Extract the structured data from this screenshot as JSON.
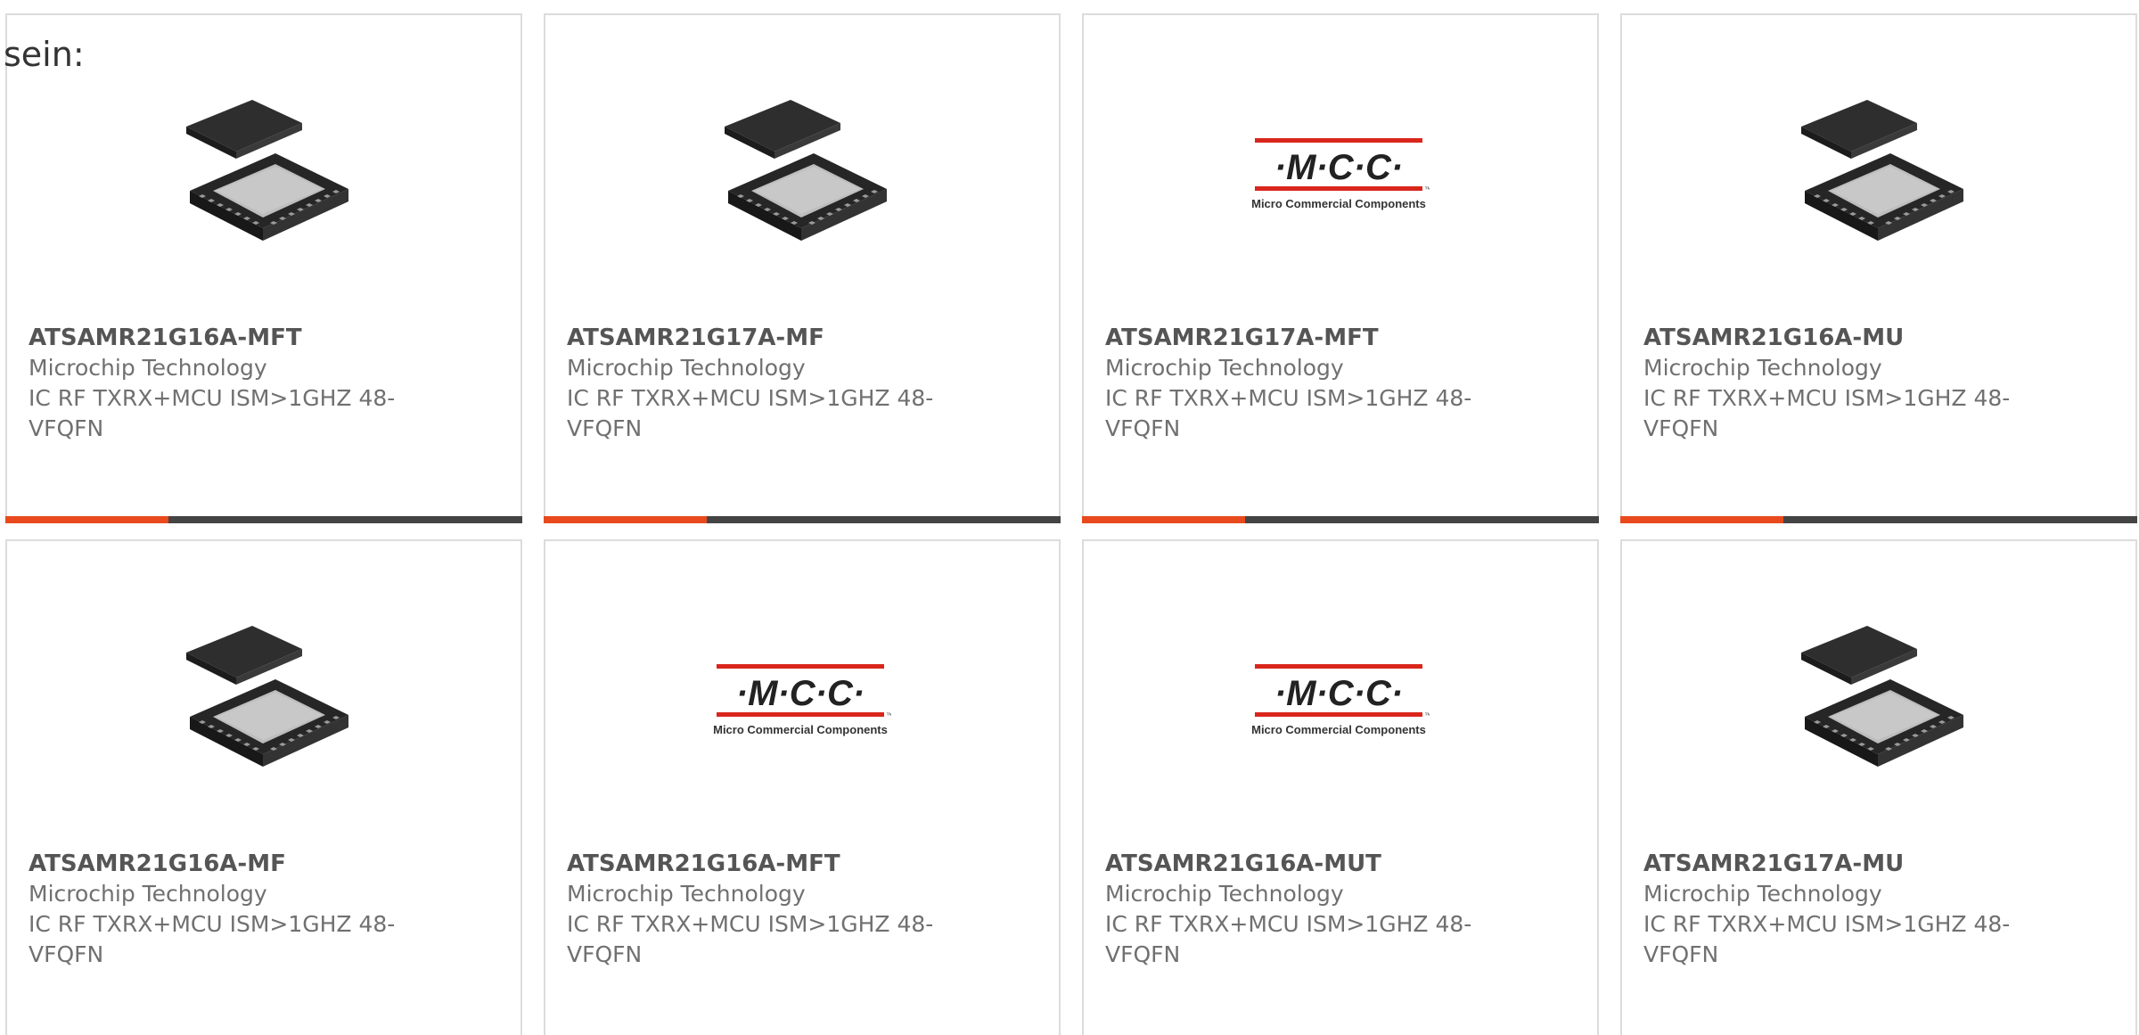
{
  "intro_text": "sein:",
  "cards": [
    {
      "part": "ATSAMR21G16A-MFT",
      "manufacturer": "Microchip Technology",
      "description": "IC RF TXRX+MCU ISM>1GHZ 48-VFQFN",
      "image": "chip-icon",
      "accent_bar": true
    },
    {
      "part": "ATSAMR21G17A-MF",
      "manufacturer": "Microchip Technology",
      "description": "IC RF TXRX+MCU ISM>1GHZ 48-VFQFN",
      "image": "chip-icon",
      "accent_bar": true
    },
    {
      "part": "ATSAMR21G17A-MFT",
      "manufacturer": "Microchip Technology",
      "description": "IC RF TXRX+MCU ISM>1GHZ 48-VFQFN",
      "image": "mcc-logo",
      "accent_bar": true
    },
    {
      "part": "ATSAMR21G16A-MU",
      "manufacturer": "Microchip Technology",
      "description": "IC RF TXRX+MCU ISM>1GHZ 48-VFQFN",
      "image": "chip-icon",
      "accent_bar": true
    },
    {
      "part": "ATSAMR21G16A-MF",
      "manufacturer": "Microchip Technology",
      "description": "IC RF TXRX+MCU ISM>1GHZ 48-VFQFN",
      "image": "chip-icon",
      "accent_bar": false
    },
    {
      "part": "ATSAMR21G16A-MFT",
      "manufacturer": "Microchip Technology",
      "description": "IC RF TXRX+MCU ISM>1GHZ 48-VFQFN",
      "image": "mcc-logo",
      "accent_bar": false
    },
    {
      "part": "ATSAMR21G16A-MUT",
      "manufacturer": "Microchip Technology",
      "description": "IC RF TXRX+MCU ISM>1GHZ 48-VFQFN",
      "image": "mcc-logo",
      "accent_bar": false
    },
    {
      "part": "ATSAMR21G17A-MU",
      "manufacturer": "Microchip Technology",
      "description": "IC RF TXRX+MCU ISM>1GHZ 48-VFQFN",
      "image": "chip-icon",
      "accent_bar": false
    }
  ],
  "mcc_logo": {
    "letters": "·M·C·C·",
    "tagline": "Micro Commercial Components",
    "tm": "™"
  },
  "colors": {
    "accent": "#e84a1d",
    "bar": "#444444",
    "mcc_red": "#d9261c",
    "border": "#dcdcdc"
  }
}
